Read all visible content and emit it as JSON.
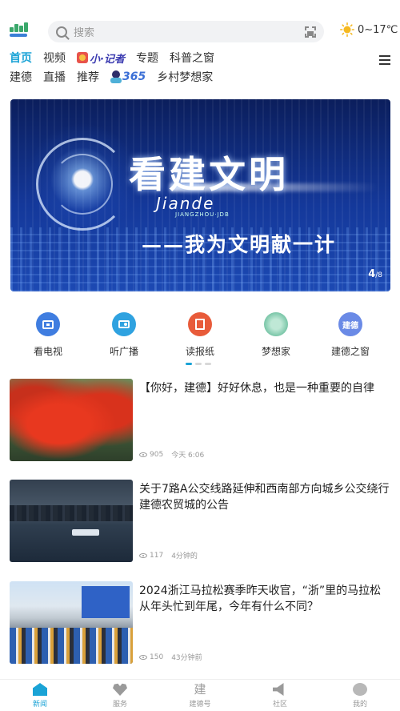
{
  "header": {
    "search_placeholder": "搜索",
    "weather": "0~17℃"
  },
  "nav": {
    "row1": [
      {
        "label": "首页",
        "active": true
      },
      {
        "label": "视频"
      },
      {
        "label": "小·记者",
        "badge": true
      },
      {
        "label": "专题"
      },
      {
        "label": "科普之窗"
      }
    ],
    "row2": [
      {
        "label": "建德"
      },
      {
        "label": "直播"
      },
      {
        "label": "推荐"
      },
      {
        "label": "365",
        "badge": true
      },
      {
        "label": "乡村梦想家"
      }
    ]
  },
  "banner": {
    "title": "看建文明",
    "brand": "Jiande",
    "brand_sub": "JIANGZHOU·JDB",
    "subtitle": "——我为文明献一计",
    "counter_current": "4",
    "counter_total": "/8"
  },
  "quick": [
    {
      "label": "看电视",
      "icon": "tv-icon"
    },
    {
      "label": "听广播",
      "icon": "radio-icon"
    },
    {
      "label": "读报纸",
      "icon": "newspaper-icon"
    },
    {
      "label": "梦想家",
      "icon": "dreamer-icon"
    },
    {
      "label": "建德之窗",
      "icon": "window-icon",
      "icon_text": "建德"
    }
  ],
  "news": [
    {
      "title": "【你好，建德】好好休息，也是一种重要的自律",
      "views": "905",
      "time": "今天 6:06"
    },
    {
      "title": "关于7路A公交线路延伸和西南部方向城乡公交绕行建德农贸城的公告",
      "views": "117",
      "time": "4分钟的"
    },
    {
      "title": "2024浙江马拉松赛季昨天收官，“浙”里的马拉松从年头忙到年尾，今年有什么不同？",
      "views": "150",
      "time": "43分钟前"
    }
  ],
  "tabbar": [
    {
      "label": "新闻",
      "active": true
    },
    {
      "label": "服务"
    },
    {
      "label": "建德号"
    },
    {
      "label": "社区"
    },
    {
      "label": "我的"
    }
  ],
  "colors": {
    "accent": "#1aa3d6",
    "banner_bg": "#14389a"
  }
}
